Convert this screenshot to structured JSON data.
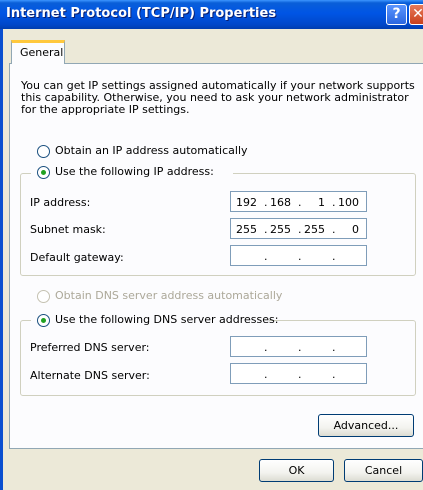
{
  "window": {
    "title": "Internet Protocol (TCP/IP) Properties",
    "help_glyph": "?",
    "close_glyph": "✕"
  },
  "tabs": [
    {
      "label": "General"
    }
  ],
  "intro_text": "You can get IP settings assigned automatically if your network supports this capability. Otherwise, you need to ask your network administrator for the appropriate IP settings.",
  "ip_section": {
    "auto_option": "Obtain an IP address automatically",
    "manual_option": "Use the following IP address:",
    "selected": "manual",
    "fields": [
      {
        "label": "IP address:",
        "octets": [
          "192",
          "168",
          "1",
          "100"
        ]
      },
      {
        "label": "Subnet mask:",
        "octets": [
          "255",
          "255",
          "255",
          "0"
        ]
      },
      {
        "label": "Default gateway:",
        "octets": [
          "",
          "",
          "",
          ""
        ]
      }
    ]
  },
  "dns_section": {
    "auto_option": "Obtain DNS server address automatically",
    "auto_enabled": false,
    "manual_option": "Use the following DNS server addresses:",
    "selected": "manual",
    "fields": [
      {
        "label": "Preferred DNS server:",
        "octets": [
          "",
          "",
          "",
          ""
        ]
      },
      {
        "label": "Alternate DNS server:",
        "octets": [
          "",
          "",
          "",
          ""
        ]
      }
    ]
  },
  "buttons": {
    "advanced": "Advanced...",
    "ok": "OK",
    "cancel": "Cancel"
  },
  "dot": "."
}
